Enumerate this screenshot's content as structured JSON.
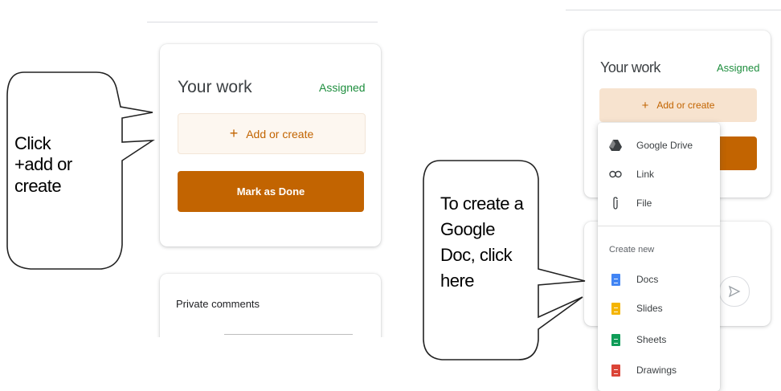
{
  "left_panel": {
    "callout_text": "Click\n+add or create",
    "your_work_title": "Your work",
    "status": "Assigned",
    "add_label": "Add or create",
    "done_label": "Mark as Done",
    "private_comments": "Private comments"
  },
  "right_panel": {
    "callout_text": "To create a Google Doc, click here",
    "your_work_title": "Your work",
    "status": "Assigned",
    "add_label": "Add or create",
    "menu": {
      "items": [
        {
          "label": "Google Drive",
          "icon": "google-drive-icon"
        },
        {
          "label": "Link",
          "icon": "link-icon"
        },
        {
          "label": "File",
          "icon": "paperclip-icon"
        }
      ],
      "create_new_label": "Create new",
      "create_items": [
        {
          "label": "Docs",
          "icon": "docs-icon",
          "color": "#4285f4"
        },
        {
          "label": "Slides",
          "icon": "slides-icon",
          "color": "#f4b400"
        },
        {
          "label": "Sheets",
          "icon": "sheets-icon",
          "color": "#0f9d58"
        },
        {
          "label": "Drawings",
          "icon": "drawings-icon",
          "color": "#db4437"
        }
      ]
    }
  },
  "colors": {
    "accent": "#c26401",
    "status_green": "#1e8e3e",
    "add_bg_left": "#fdf7f0",
    "add_bg_right": "#f7e3cf"
  }
}
